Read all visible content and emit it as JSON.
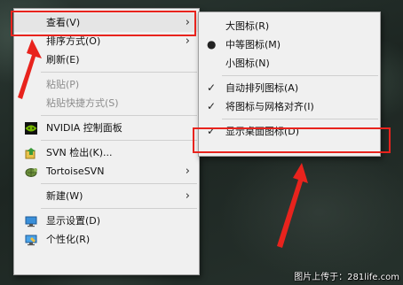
{
  "context_menu": {
    "items": [
      {
        "label": "查看(V)",
        "has_submenu": true
      },
      {
        "label": "排序方式(O)",
        "has_submenu": true
      },
      {
        "label": "刷新(E)"
      },
      {
        "label": "粘贴(P)",
        "disabled": true
      },
      {
        "label": "粘贴快捷方式(S)",
        "disabled": true
      },
      {
        "label": "NVIDIA 控制面板",
        "icon": "nvidia-icon"
      },
      {
        "label": "SVN 检出(K)...",
        "icon": "svn-checkout-icon"
      },
      {
        "label": "TortoiseSVN",
        "icon": "tortoisesvn-icon",
        "has_submenu": true
      },
      {
        "label": "新建(W)",
        "has_submenu": true
      },
      {
        "label": "显示设置(D)",
        "icon": "display-settings-icon"
      },
      {
        "label": "个性化(R)",
        "icon": "personalize-icon"
      }
    ]
  },
  "view_submenu": {
    "items": [
      {
        "label": "大图标(R)"
      },
      {
        "label": "中等图标(M)",
        "selected": true,
        "marker": "●"
      },
      {
        "label": "小图标(N)"
      },
      {
        "label": "自动排列图标(A)",
        "checked": true,
        "marker": "✓"
      },
      {
        "label": "将图标与网格对齐(I)",
        "checked": true,
        "marker": "✓"
      },
      {
        "label": "显示桌面图标(D)",
        "checked": true,
        "marker": "✓"
      }
    ]
  },
  "arrow_glyph": "›",
  "colors": {
    "highlight_border": "#e8231d",
    "nvidia_green": "#76b900",
    "menu_background": "#f0f0f0"
  },
  "watermark": "图片上传于：281life.com"
}
